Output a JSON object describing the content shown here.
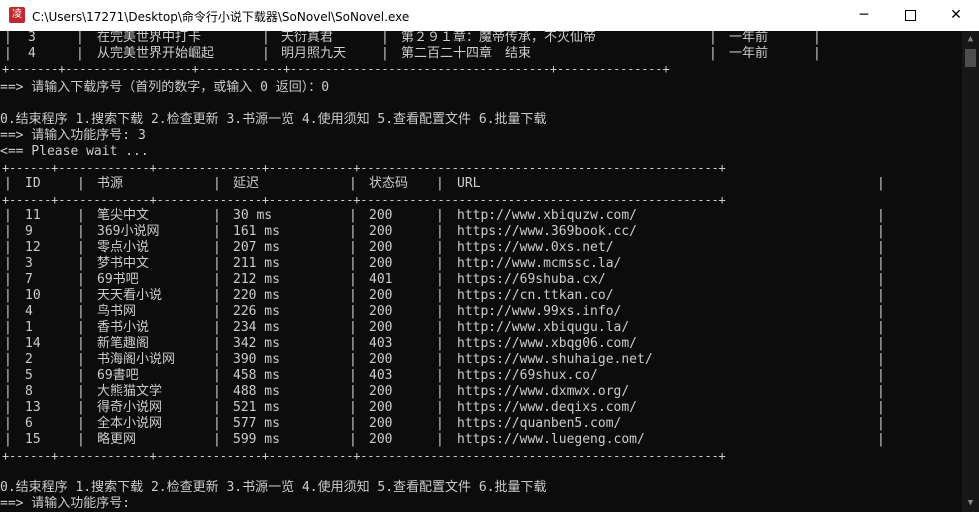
{
  "window": {
    "app_icon_char": "凌",
    "title": "C:\\Users\\17271\\Desktop\\命令行小说下载器\\SoNovel\\SoNovel.exe",
    "minimize_symbol": "─",
    "close_symbol": "✕"
  },
  "search_table": {
    "rows": [
      {
        "index": "3",
        "title": "在完美世界中打卡",
        "author": "天衍真君",
        "chapter": "第２９１章：魔帝传承，不灭仙帝",
        "updated": "一年前"
      },
      {
        "index": "4",
        "title": "从完美世界开始崛起",
        "author": "明月照九天",
        "chapter": "第二百二十四章　结束",
        "updated": "一年前"
      }
    ],
    "border": "+-------+------------------+------------+-------------------------------------+---------------+"
  },
  "prompts": {
    "download_prompt": "==> 请输入下载序号（首列的数字，或输入 0 返回）：0",
    "menu": "0.结束程序 1.搜索下载 2.检查更新 3.书源一览 4.使用须知 5.查看配置文件 6.批量下载",
    "func_prompt_filled": "==> 请输入功能序号: 3",
    "wait": "<== Please wait ...",
    "menu_repeat": "0.结束程序 1.搜索下载 2.检查更新 3.书源一览 4.使用须知 5.查看配置文件 6.批量下载",
    "func_prompt_empty": "==> 请输入功能序号:"
  },
  "sources_table": {
    "border": "+------+-------------+---------------+------------+---------------------------------------------------+",
    "headers": {
      "id": "ID",
      "name": "书源",
      "delay": "延迟",
      "status": "状态码",
      "url": "URL"
    },
    "rows": [
      {
        "id": "11",
        "name": "笔尖中文",
        "delay": "30 ms",
        "status": "200",
        "url": "http://www.xbiquzw.com/"
      },
      {
        "id": "9",
        "name": "369小说网",
        "delay": "161 ms",
        "status": "200",
        "url": "https://www.369book.cc/"
      },
      {
        "id": "12",
        "name": "零点小说",
        "delay": "207 ms",
        "status": "200",
        "url": "https://www.0xs.net/"
      },
      {
        "id": "3",
        "name": "梦书中文",
        "delay": "211 ms",
        "status": "200",
        "url": "http://www.mcmssc.la/"
      },
      {
        "id": "7",
        "name": "69书吧",
        "delay": "212 ms",
        "status": "401",
        "url": "https://69shuba.cx/"
      },
      {
        "id": "10",
        "name": "天天看小说",
        "delay": "220 ms",
        "status": "200",
        "url": "https://cn.ttkan.co/"
      },
      {
        "id": "4",
        "name": "鸟书网",
        "delay": "226 ms",
        "status": "200",
        "url": "http://www.99xs.info/"
      },
      {
        "id": "1",
        "name": "香书小说",
        "delay": "234 ms",
        "status": "200",
        "url": "http://www.xbiqugu.la/"
      },
      {
        "id": "14",
        "name": "新笔趣阁",
        "delay": "342 ms",
        "status": "403",
        "url": "https://www.xbqg06.com/"
      },
      {
        "id": "2",
        "name": "书海阁小说网",
        "delay": "390 ms",
        "status": "200",
        "url": "https://www.shuhaige.net/"
      },
      {
        "id": "5",
        "name": "69書吧",
        "delay": "458 ms",
        "status": "403",
        "url": "https://69shux.co/"
      },
      {
        "id": "8",
        "name": "大熊猫文学",
        "delay": "488 ms",
        "status": "200",
        "url": "https://www.dxmwx.org/"
      },
      {
        "id": "13",
        "name": "得奇小说网",
        "delay": "521 ms",
        "status": "200",
        "url": "https://www.deqixs.com/"
      },
      {
        "id": "6",
        "name": "全本小说网",
        "delay": "577 ms",
        "status": "200",
        "url": "https://quanben5.com/"
      },
      {
        "id": "15",
        "name": "略更网",
        "delay": "599 ms",
        "status": "200",
        "url": "https://www.luegeng.com/"
      }
    ]
  },
  "colors": {
    "console_bg": "#0c0c0c",
    "console_fg": "#cccccc",
    "titlebar_bg": "#ffffff",
    "icon_red": "#c4262e"
  },
  "icons": {
    "app": "app-icon",
    "minimize": "minimize-icon",
    "maximize": "maximize-icon",
    "close": "close-icon",
    "scroll_up": "scroll-up-arrow-icon",
    "scroll_down": "scroll-down-arrow-icon"
  },
  "scrollbar": {
    "up_arrow": "▲",
    "down_arrow": "▼"
  }
}
